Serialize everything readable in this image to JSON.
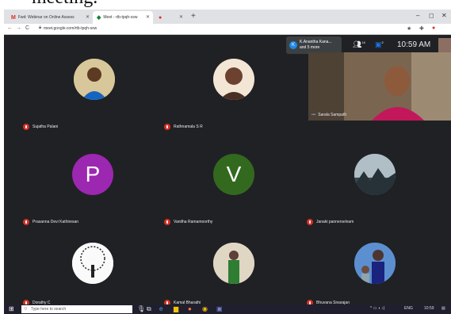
{
  "heading": "meeting.",
  "browser": {
    "tabs": [
      {
        "favicon": "M",
        "title": "Fwd: Webinar on Online Assess",
        "color": "#d93025"
      },
      {
        "favicon": "◆",
        "title": "Meet - rtb-tpqh-ssw",
        "color": "#188038",
        "active": true
      },
      {
        "favicon": "●",
        "title": "",
        "color": "#d93025"
      }
    ],
    "new_tab": "+",
    "window_controls": [
      "–",
      "◻",
      "✕"
    ],
    "nav": [
      "←",
      "→",
      "C"
    ],
    "url": "meet.google.com/rtb-tpqh-ssw",
    "extensions": [
      "★",
      "✚",
      "●"
    ]
  },
  "meeting": {
    "top_info": {
      "initial": "K",
      "line1": "K.Anantha Kana...",
      "line2": "and 5 more",
      "people_count": "16",
      "chat_badge": "2",
      "time": "10:59 AM"
    },
    "presenter": {
      "name": "Sarala Sampath"
    },
    "participants": [
      {
        "name": "Sujatha Palani",
        "type": "photo",
        "color": "#c9a66b"
      },
      {
        "name": "Rathnamala S R",
        "type": "photo",
        "color": "#8a5a44"
      },
      {
        "name": "Prasanna Devi Kathiresan",
        "type": "letter",
        "letter": "P",
        "color": "#9c27b0"
      },
      {
        "name": "Vanitha Ramamoorthy",
        "type": "letter",
        "letter": "V",
        "color": "#33691e"
      },
      {
        "name": "Janaki pannerselvam",
        "type": "photo",
        "color": "#8fa4b8"
      },
      {
        "name": "Dorathy C",
        "type": "photo",
        "color": "#f2f2f2"
      },
      {
        "name": "Kamal Bharathi",
        "type": "photo",
        "color": "#c8b8a0"
      },
      {
        "name": "Bhuvana Sivarajan",
        "type": "photo",
        "color": "#4a7fc1"
      }
    ]
  },
  "taskbar": {
    "search_placeholder": "Type here to search",
    "tray_text": "ENG",
    "time": "10:59"
  },
  "colors": {
    "meet_bg": "#202124",
    "mic_off": "#d93025"
  }
}
